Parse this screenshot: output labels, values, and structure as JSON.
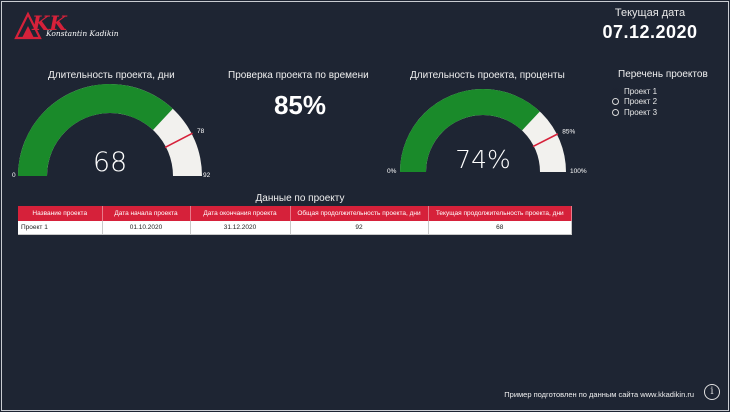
{
  "colors": {
    "background": "#1e2533",
    "gauge_fill": "#1a8a2a",
    "gauge_track": "#f2f1ee",
    "target_line": "#d6213a",
    "header_red": "#d6213a"
  },
  "logo": {
    "mark": "KK",
    "subtitle": "Konstantin Kadikin"
  },
  "header": {
    "date_label": "Текущая дата",
    "date_value": "07.12.2020"
  },
  "gauge_days": {
    "title": "Длительность проекта, дни",
    "value": 68,
    "value_label": "68",
    "min": 0,
    "max": 92,
    "target": 78,
    "min_label": "0",
    "max_label": "92",
    "target_label": "78"
  },
  "check": {
    "title": "Проверка проекта по времени",
    "value": "85%"
  },
  "gauge_percent": {
    "title": "Длительность проекта, проценты",
    "value": 74,
    "value_label": "74%",
    "min": 0,
    "max": 100,
    "target": 85,
    "min_label": "0%",
    "max_label": "100%",
    "target_label": "85%"
  },
  "legend": {
    "title": "Перечень проектов",
    "items": [
      "Проект 1",
      "Проект 2",
      "Проект 3"
    ],
    "selected": "Проект 1"
  },
  "table": {
    "title": "Данные по проекту",
    "columns": [
      "Название проекта",
      "Дата начала проекта",
      "Дата окончания проекта",
      "Общая продолжительность проекта, дни",
      "Текущая продолжительность проекта, дни"
    ],
    "rows": [
      [
        "Проект 1",
        "01.10.2020",
        "31.12.2020",
        "92",
        "68"
      ]
    ]
  },
  "footer": {
    "text": "Пример подготовлен по данным сайта www.kkadikin.ru",
    "info_icon": "info-icon"
  }
}
